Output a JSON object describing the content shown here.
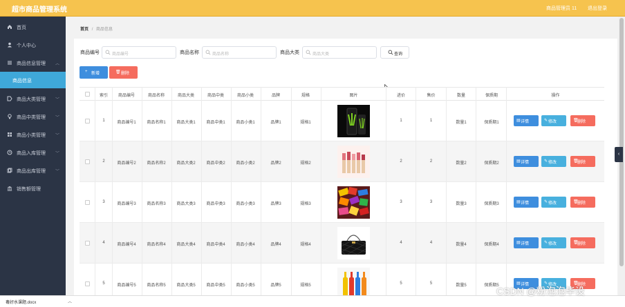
{
  "topbar": {
    "title": "超市商品管理系统",
    "user": "商品管理员 11",
    "logout": "退出登录"
  },
  "sidebar": {
    "items": [
      {
        "label": "首页",
        "icon": "home-icon"
      },
      {
        "label": "个人中心",
        "icon": "user-icon"
      },
      {
        "label": "商品信息管理",
        "icon": "menu-icon"
      },
      {
        "label": "商品大类管理",
        "icon": "tag-icon"
      },
      {
        "label": "商品中类管理",
        "icon": "bulb-icon"
      },
      {
        "label": "商品小类管理",
        "icon": "grid-icon"
      },
      {
        "label": "商品入库管理",
        "icon": "clock-icon"
      },
      {
        "label": "商品出库管理",
        "icon": "copy-icon"
      },
      {
        "label": "销售额管理",
        "icon": "bank-icon"
      }
    ],
    "sub_active": "商品信息"
  },
  "breadcrumb": {
    "home": "首页",
    "sep": "/",
    "current": "商品信息"
  },
  "search": {
    "code_label": "商品编号",
    "code_placeholder": "商品编号",
    "name_label": "商品名称",
    "name_placeholder": "商品名称",
    "category_label": "商品大类",
    "category_placeholder": "商品大类",
    "query_label": "查询"
  },
  "actions": {
    "add_label": "新增",
    "delete_label": "删除"
  },
  "table": {
    "headers": [
      "索引",
      "商品编号",
      "商品名称",
      "商品大类",
      "商品中类",
      "商品小类",
      "品牌",
      "规格",
      "图片",
      "进价",
      "售价",
      "数量",
      "保质期",
      "操作"
    ],
    "rows": [
      {
        "index": "1",
        "code": "商品编号1",
        "name": "商品名称1",
        "big": "商品大类1",
        "mid": "商品中类1",
        "small": "商品小类1",
        "brand": "品牌1",
        "spec": "规格1",
        "cost": "1",
        "price": "1",
        "qty": "数量1",
        "shelf": "保质期1",
        "image": "energy-drink-can"
      },
      {
        "index": "2",
        "code": "商品编号2",
        "name": "商品名称2",
        "big": "商品大类2",
        "mid": "商品中类2",
        "small": "商品小类2",
        "brand": "品牌2",
        "spec": "规格2",
        "cost": "2",
        "price": "2",
        "qty": "数量2",
        "shelf": "保质期2",
        "image": "lipsticks"
      },
      {
        "index": "3",
        "code": "商品编号3",
        "name": "商品名称3",
        "big": "商品大类3",
        "mid": "商品中类3",
        "small": "商品小类3",
        "brand": "品牌3",
        "spec": "规格3",
        "cost": "3",
        "price": "3",
        "qty": "数量3",
        "shelf": "保质期3",
        "image": "candy-pile"
      },
      {
        "index": "4",
        "code": "商品编号4",
        "name": "商品名称4",
        "big": "商品大类4",
        "mid": "商品中类4",
        "small": "商品小类4",
        "brand": "品牌4",
        "spec": "规格4",
        "cost": "4",
        "price": "4",
        "qty": "数量4",
        "shelf": "保质期4",
        "image": "black-handbag"
      },
      {
        "index": "5",
        "code": "商品编号5",
        "name": "商品名称5",
        "big": "商品大类5",
        "mid": "商品中类5",
        "small": "商品小类5",
        "brand": "品牌5",
        "spec": "规格5",
        "cost": "5",
        "price": "5",
        "qty": "数量5",
        "shelf": "保质期5",
        "image": "bottles"
      }
    ],
    "op_detail": "详情",
    "op_edit": "修改",
    "op_delete": "删除"
  },
  "download_bar": {
    "file": "毒好水课题.docx"
  },
  "watermark": "CSDN @粉泡泡毕设",
  "colors": {
    "topbar": "#f6c34e",
    "sidebar": "#2b3445",
    "active": "#3fa8d9",
    "primary": "#3e8ede",
    "danger": "#f56c5e"
  }
}
